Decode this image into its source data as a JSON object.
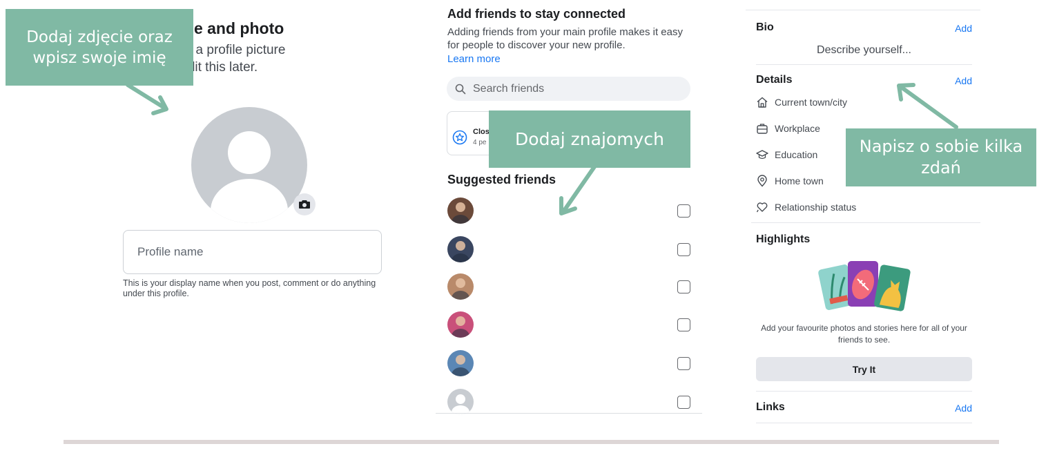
{
  "panel1": {
    "title": "ofile name and photo",
    "subtitle_line1": "e by adding a profile picture",
    "subtitle_line2": "You can edit this later.",
    "profile_name_placeholder": "Profile name",
    "help_text": "This is your display name when you post, comment or do anything under this profile."
  },
  "panel2": {
    "title": "Add friends to stay connected",
    "description": "Adding friends from your main profile makes it easy for people to discover your new profile.",
    "learn_more": "Learn more",
    "search_placeholder": "Search friends",
    "close_friends_title": "Clos",
    "close_friends_count": "4 pe",
    "suggested_title": "Suggested friends",
    "friends": [
      {
        "avatar": "photo",
        "color": "#6b4a3a",
        "checked": false
      },
      {
        "avatar": "photo",
        "color": "#3a4660",
        "checked": false
      },
      {
        "avatar": "photo",
        "color": "#b98a6a",
        "checked": false
      },
      {
        "avatar": "photo",
        "color": "#c9507a",
        "checked": false
      },
      {
        "avatar": "photo",
        "color": "#5b87b5",
        "checked": false
      },
      {
        "avatar": "default",
        "color": "#c8ccd1",
        "checked": false
      }
    ]
  },
  "panel3": {
    "bio_title": "Bio",
    "bio_add": "Add",
    "bio_placeholder": "Describe yourself...",
    "details_title": "Details",
    "details_add": "Add",
    "details": [
      {
        "icon": "house-icon",
        "label": "Current town/city"
      },
      {
        "icon": "briefcase-icon",
        "label": "Workplace"
      },
      {
        "icon": "graduation-cap-icon",
        "label": "Education"
      },
      {
        "icon": "location-pin-icon",
        "label": "Home town"
      },
      {
        "icon": "heart-icon",
        "label": "Relationship status"
      }
    ],
    "highlights_title": "Highlights",
    "highlights_text": "Add your favourite photos and stories here for all of your friends to see.",
    "try_it": "Try It",
    "links_title": "Links",
    "links_add": "Add"
  },
  "annotations": {
    "photo_name": "Dodaj zdjęcie oraz wpisz swoje imię",
    "add_friends": "Dodaj znajomych",
    "about_you": "Napisz o sobie kilka zdań"
  },
  "colors": {
    "accent_blue": "#1877f2",
    "annotation_green": "#80b9a4"
  }
}
